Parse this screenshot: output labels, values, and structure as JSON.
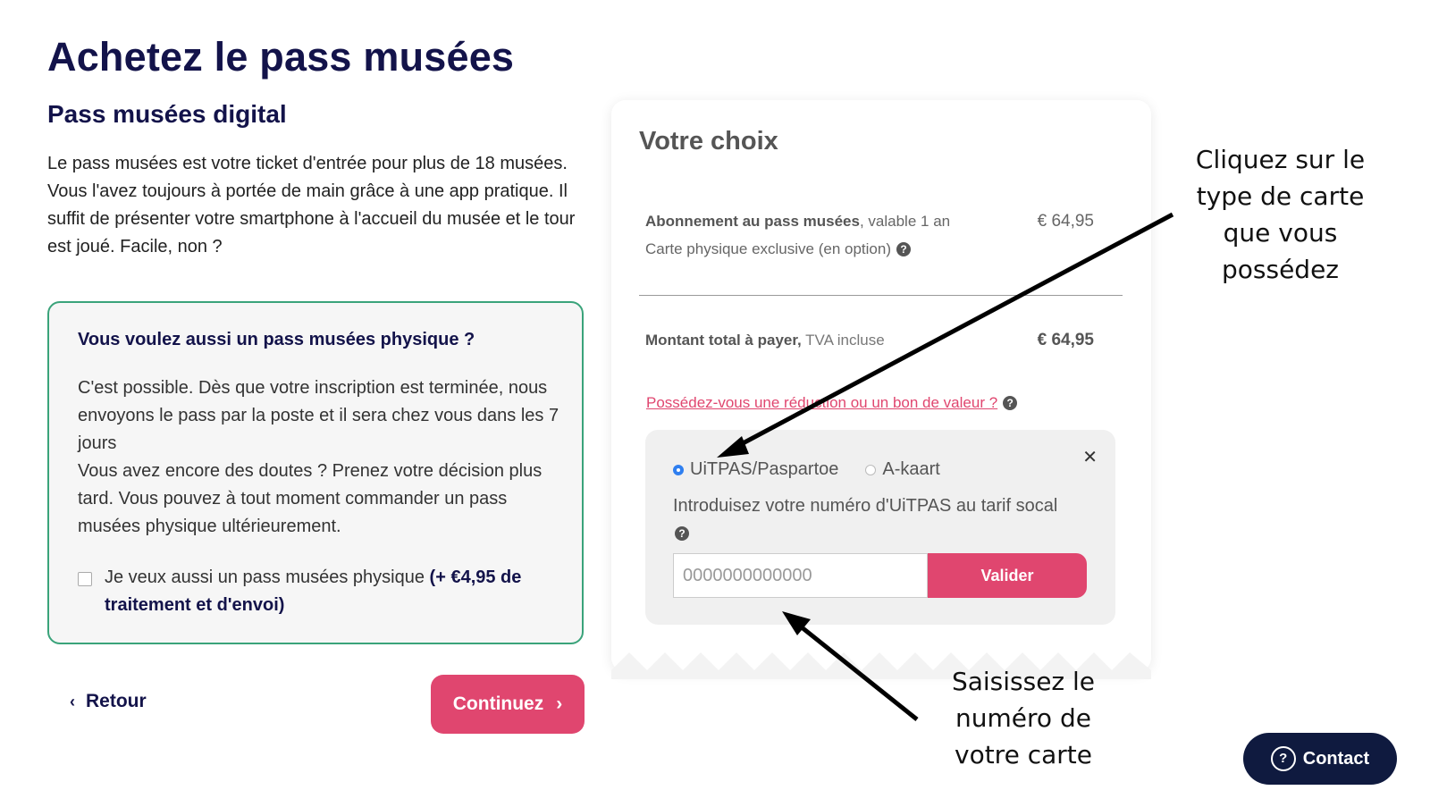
{
  "page": {
    "title": "Achetez le pass musées",
    "subtitle": "Pass musées digital",
    "intro": "Le pass musées est votre ticket d'entrée pour plus de 18 musées. Vous l'avez toujours à portée de main grâce à une app pratique. Il suffit de présenter votre smartphone à l'accueil du musée et le tour est joué. Facile, non ?"
  },
  "physical": {
    "question": "Vous voulez aussi un pass musées physique ?",
    "desc_line1": "C'est possible. Dès que votre inscription est terminée, nous envoyons le pass par la poste et il sera chez vous dans les 7 jours",
    "desc_line2": "Vous avez encore des doutes ? Prenez votre décision plus tard. Vous pouvez à tout moment commander un pass musées physique ultérieurement.",
    "checkbox_label": "Je veux aussi un pass musées physique ",
    "checkbox_bold": "(+ €4,95 de traitement et d'envoi)"
  },
  "nav": {
    "back_label": "Retour",
    "continue_label": "Continuez"
  },
  "choice": {
    "heading": "Votre choix",
    "item_bold": "Abonnement au pass musées",
    "item_rest": ", valable 1 an",
    "item_option": "Carte physique exclusive (en option)",
    "item_price": "€ 64,95",
    "total_bold": "Montant total à payer,",
    "total_rest": " TVA incluse",
    "total_price": "€ 64,95",
    "promo_link": "Possédez-vous une réduction ou un bon de valeur ?"
  },
  "discount": {
    "option1": "UiTPAS/Paspartoe",
    "option2": "A-kaart",
    "instruction": "Introduisez votre numéro d'UiTPAS au tarif socal",
    "placeholder": "0000000000000",
    "validate_label": "Valider"
  },
  "annotations": {
    "card_type": "Cliquez sur le type de carte que vous possédez",
    "card_number": "Saisissez le numéro de votre carte"
  },
  "contact": {
    "label": "Contact"
  },
  "colors": {
    "accent": "#e0466f",
    "navy": "#13134a",
    "green": "#3aa37a",
    "radio": "#2f7ff0"
  }
}
